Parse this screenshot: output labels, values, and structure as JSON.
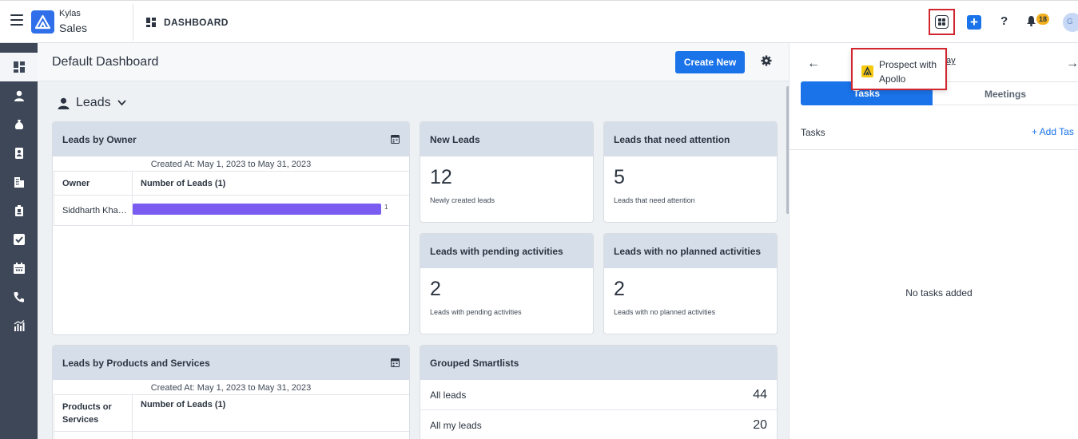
{
  "header": {
    "brand_line1": "Kylas",
    "brand_line2": "Sales",
    "section_title": "DASHBOARD",
    "notification_count": "18",
    "avatar_initial": "G"
  },
  "sidebar": {
    "items": [
      {
        "icon": "dashboard-icon",
        "active": true
      },
      {
        "icon": "user-icon"
      },
      {
        "icon": "money-bag-icon"
      },
      {
        "icon": "contact-card-icon"
      },
      {
        "icon": "building-icon"
      },
      {
        "icon": "clipboard-icon"
      },
      {
        "icon": "checkbox-icon"
      },
      {
        "icon": "calendar-icon"
      },
      {
        "icon": "phone-icon"
      },
      {
        "icon": "report-chart-icon"
      }
    ]
  },
  "main": {
    "title": "Default Dashboard",
    "create_label": "Create New",
    "entity_selector": "Leads",
    "leads_by_owner": {
      "title": "Leads by Owner",
      "created": "Created At: May 1, 2023 to May 31, 2023",
      "col1": "Owner",
      "col2": "Number of Leads (1)",
      "rows": [
        {
          "owner": "Siddharth Kha…",
          "value": 1
        }
      ],
      "bar_color": "#7b5cf0"
    },
    "stats": [
      {
        "title": "New Leads",
        "value": "12",
        "subtitle": "Newly created leads"
      },
      {
        "title": "Leads that need attention",
        "value": "5",
        "subtitle": "Leads that need attention"
      },
      {
        "title": "Leads with pending activities",
        "value": "2",
        "subtitle": "Leads with pending activities"
      },
      {
        "title": "Leads with no planned activities",
        "value": "2",
        "subtitle": "Leads with no planned activities"
      }
    ],
    "leads_by_products": {
      "title": "Leads by Products and Services",
      "created": "Created At: May 1, 2023 to May 31, 2023",
      "col1": "Products or Services",
      "col2": "Number of Leads (1)"
    },
    "smartlists": {
      "title": "Grouped Smartlists",
      "rows": [
        {
          "label": "All leads",
          "count": "44"
        },
        {
          "label": "All my leads",
          "count": "20"
        }
      ]
    }
  },
  "right_panel": {
    "heading_fragment": "ay",
    "tabs": [
      "Tasks",
      "Meetings"
    ],
    "tasks_label": "Tasks",
    "add_task_label": "+ Add Tas",
    "empty_label": "No tasks added"
  },
  "popup": {
    "text": "Prospect with Apollo"
  },
  "colors": {
    "accent": "#1a73e8",
    "sidebar": "#3d4758",
    "highlight": "#d2262f"
  }
}
